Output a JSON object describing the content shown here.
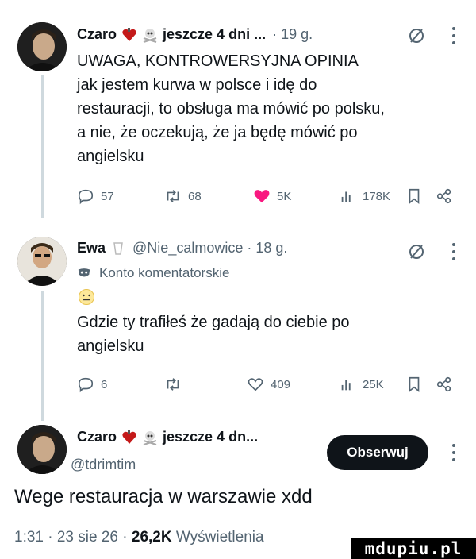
{
  "tweets": [
    {
      "author": "Czaro",
      "handle_time": "jeszcze 4 dni ...",
      "time": "· 19 g.",
      "text_lines": [
        "UWAGA, KONTROWERSYJNA OPINIA",
        "jak jestem kurwa w polsce i idę do",
        "restauracji, to obsługa ma mówić po polsku,",
        "a nie, że oczekują, że ja będę mówić po",
        "angielsku"
      ],
      "stats": {
        "replies": "57",
        "reposts": "68",
        "likes": "5K",
        "views": "178K"
      }
    },
    {
      "author": "Ewa",
      "handle": "@Nie_calmowice · 18 g.",
      "account_label": "Konto komentatorskie",
      "text_lines": [
        "Gdzie ty trafiłeś że gadają do ciebie po",
        "angielsku"
      ],
      "stats": {
        "replies": "6",
        "reposts": "",
        "likes": "409",
        "views": "25K"
      }
    }
  ],
  "main_tweet": {
    "author": "Czaro",
    "handle_time": "jeszcze 4 dn...",
    "handle": "@tdrimtim",
    "follow_label": "Obserwuj",
    "text": "Wege restauracja w warszawie xdd",
    "footer_time": "1:31 · 23 sie 26 ·",
    "footer_views": "26,2K",
    "footer_views_label": "Wyświetlenia"
  },
  "watermark": "mdupiu.pl",
  "colors": {
    "text": "#0f1419",
    "muted": "#536471",
    "like_active": "#f91880",
    "thread_line": "#cfd9de"
  }
}
